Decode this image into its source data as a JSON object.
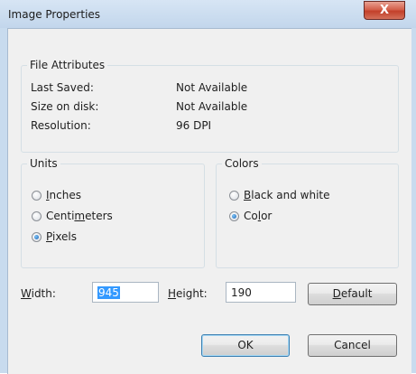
{
  "window": {
    "title": "Image Properties",
    "close_glyph": "X"
  },
  "file_attributes": {
    "legend": "File Attributes",
    "rows": [
      {
        "key": "Last Saved:",
        "value": "Not Available"
      },
      {
        "key": "Size on disk:",
        "value": "Not Available"
      },
      {
        "key": "Resolution:",
        "value": "96 DPI"
      }
    ]
  },
  "units": {
    "legend": "Units",
    "options": [
      {
        "pre": "",
        "mnemonic": "I",
        "post": "nches",
        "checked": false
      },
      {
        "pre": "Centi",
        "mnemonic": "m",
        "post": "eters",
        "checked": false
      },
      {
        "pre": "",
        "mnemonic": "P",
        "post": "ixels",
        "checked": true
      }
    ]
  },
  "colors": {
    "legend": "Colors",
    "options": [
      {
        "pre": "",
        "mnemonic": "B",
        "post": "lack and white",
        "checked": false
      },
      {
        "pre": "Co",
        "mnemonic": "l",
        "post": "or",
        "checked": true
      }
    ]
  },
  "size": {
    "width_label_mn": "W",
    "width_label_rest": "idth:",
    "width_value": "945",
    "height_label_mn": "H",
    "height_label_rest": "eight:",
    "height_value": "190"
  },
  "buttons": {
    "default_mn": "D",
    "default_rest": "efault",
    "ok": "OK",
    "cancel": "Cancel"
  }
}
